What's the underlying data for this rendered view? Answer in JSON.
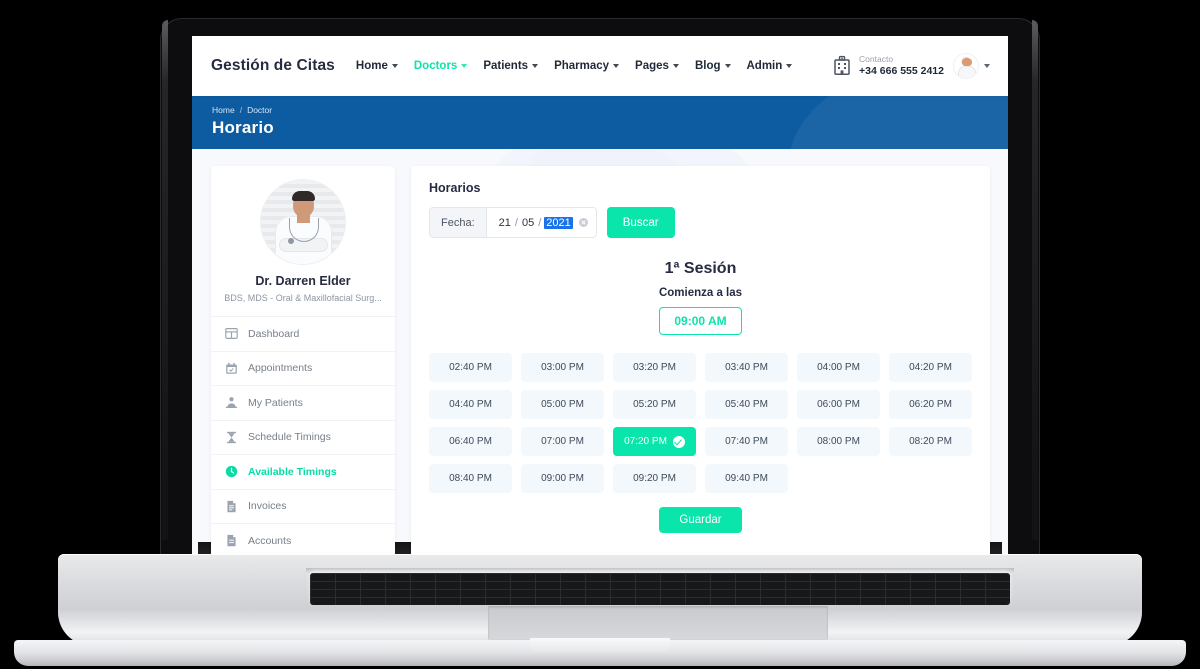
{
  "header": {
    "brand": "Gestión de Citas",
    "nav": [
      {
        "label": "Home",
        "active": false
      },
      {
        "label": "Doctors",
        "active": true
      },
      {
        "label": "Patients",
        "active": false
      },
      {
        "label": "Pharmacy",
        "active": false
      },
      {
        "label": "Pages",
        "active": false
      },
      {
        "label": "Blog",
        "active": false
      },
      {
        "label": "Admin",
        "active": false
      }
    ],
    "contact_label": "Contacto",
    "contact_phone": "+34 666 555 2412"
  },
  "breadcrumb": {
    "home": "Home",
    "separator": "/",
    "current": "Doctor",
    "title": "Horario"
  },
  "sidebar": {
    "doctor_name": "Dr. Darren Elder",
    "doctor_specialty": "BDS, MDS - Oral & Maxillofacial Surg...",
    "items": [
      {
        "label": "Dashboard",
        "icon": "dashboard-icon",
        "active": false
      },
      {
        "label": "Appointments",
        "icon": "calendar-icon",
        "active": false
      },
      {
        "label": "My Patients",
        "icon": "patients-icon",
        "active": false
      },
      {
        "label": "Schedule Timings",
        "icon": "hourglass-icon",
        "active": false
      },
      {
        "label": "Available Timings",
        "icon": "clock-icon",
        "active": true
      },
      {
        "label": "Invoices",
        "icon": "invoice-icon",
        "active": false
      },
      {
        "label": "Accounts",
        "icon": "accounts-icon",
        "active": false
      }
    ]
  },
  "main": {
    "card_title": "Horarios",
    "date_label": "Fecha:",
    "date": {
      "day": "21",
      "month": "05",
      "year": "2021",
      "selected_segment": "year"
    },
    "search_button": "Buscar",
    "session_title": "1ª Sesión",
    "session_subtitle": "Comienza a las",
    "session_start": "09:00 AM",
    "slots": [
      {
        "time": "02:40 PM",
        "selected": false
      },
      {
        "time": "03:00 PM",
        "selected": false
      },
      {
        "time": "03:20 PM",
        "selected": false
      },
      {
        "time": "03:40 PM",
        "selected": false
      },
      {
        "time": "04:00 PM",
        "selected": false
      },
      {
        "time": "04:20 PM",
        "selected": false
      },
      {
        "time": "04:40 PM",
        "selected": false
      },
      {
        "time": "05:00 PM",
        "selected": false
      },
      {
        "time": "05:20 PM",
        "selected": false
      },
      {
        "time": "05:40 PM",
        "selected": false
      },
      {
        "time": "06:00 PM",
        "selected": false
      },
      {
        "time": "06:20 PM",
        "selected": false
      },
      {
        "time": "06:40 PM",
        "selected": false
      },
      {
        "time": "07:00 PM",
        "selected": false
      },
      {
        "time": "07:20 PM",
        "selected": true
      },
      {
        "time": "07:40 PM",
        "selected": false
      },
      {
        "time": "08:00 PM",
        "selected": false
      },
      {
        "time": "08:20 PM",
        "selected": false
      },
      {
        "time": "08:40 PM",
        "selected": false
      },
      {
        "time": "09:00 PM",
        "selected": false
      },
      {
        "time": "09:20 PM",
        "selected": false
      },
      {
        "time": "09:40 PM",
        "selected": false
      }
    ],
    "save_button": "Guardar"
  },
  "colors": {
    "accent_green": "#09e5ab",
    "brand_blue": "#0d5ca1",
    "slot_bg": "#f2f8fc",
    "text_dark": "#272b41",
    "selection_blue": "#1a73e8"
  }
}
